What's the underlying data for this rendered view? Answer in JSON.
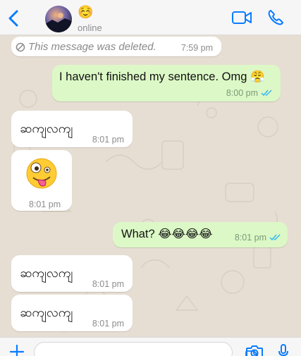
{
  "header": {
    "contact_emoji": "☺️",
    "status": "online",
    "icons": [
      "back-chevron-icon",
      "video-call-icon",
      "phone-call-icon"
    ]
  },
  "messages": [
    {
      "direction": "in",
      "deleted": true,
      "text": "This message was deleted.",
      "time": "7:59 pm"
    },
    {
      "direction": "out",
      "text": "I haven't finished my sentence. Omg 😤",
      "time": "8:00 pm",
      "read": true
    },
    {
      "direction": "in",
      "text": "ဆကျလကျ",
      "time": "8:01 pm"
    },
    {
      "direction": "in",
      "emoji": "zany-face",
      "time": "8:01 pm"
    },
    {
      "direction": "out",
      "text": "What? 😂😂😂😂",
      "time": "8:01 pm",
      "read": true
    },
    {
      "direction": "in",
      "text": "ဆကျလကျ",
      "time": "8:01 pm"
    },
    {
      "direction": "in",
      "text": "ဆကျလကျ",
      "time": "8:01 pm"
    }
  ],
  "composer": {
    "icons": [
      "plus-icon",
      "sticker-icon",
      "camera-icon",
      "microphone-icon"
    ]
  },
  "colors": {
    "accent": "#0a7cff",
    "outgoing_bubble": "#dcf8c6",
    "incoming_bubble": "#ffffff",
    "read_ticks": "#34b7f1",
    "chat_background": "#e6ded3"
  }
}
